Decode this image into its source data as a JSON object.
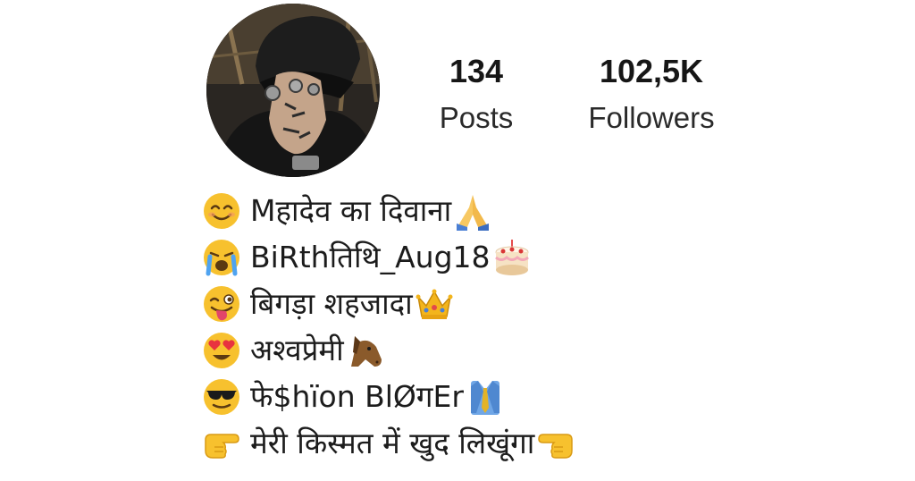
{
  "profile": {
    "avatar_icon": "avatar",
    "stats": {
      "posts_value": "134",
      "posts_label": "Posts",
      "followers_value": "102,5K",
      "followers_label": "Followers"
    }
  },
  "bio": {
    "lines": [
      {
        "lead_icon": "smiling-face-icon",
        "text": "Mहादेव का दिवाना",
        "trail_icon": "folded-hands-icon"
      },
      {
        "lead_icon": "crying-face-icon",
        "text": "BiRthतिथि_Aug18",
        "trail_icon": "birthday-cake-icon"
      },
      {
        "lead_icon": "winking-tongue-face-icon",
        "text": "बिगड़ा शहजादा",
        "trail_icon": "crown-icon"
      },
      {
        "lead_icon": "heart-eyes-face-icon",
        "text": "अश्वप्रेमी",
        "trail_icon": "horse-face-icon"
      },
      {
        "lead_icon": "sunglasses-face-icon",
        "text": "फे$hïon BlØगEr",
        "trail_icon": "suit-tie-icon"
      },
      {
        "lead_icon": "pointing-right-icon",
        "text": "मेरी किस्मत में खुद लिखूंगा",
        "trail_icon": "pointing-left-icon"
      }
    ]
  },
  "colors": {
    "emoji_yellow": "#f7c12e",
    "emoji_shade": "#e49b13",
    "text": "#1c1c1c",
    "background": "#ffffff"
  }
}
